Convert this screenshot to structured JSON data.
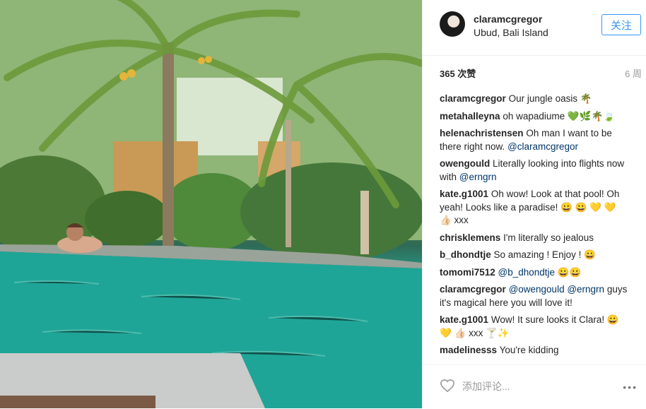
{
  "header": {
    "username": "claramcgregor",
    "location": "Ubud, Bali Island",
    "follow_label": "关注"
  },
  "stats": {
    "likes": "365 次赞",
    "ago": "6 周"
  },
  "comments": [
    {
      "user": "claramcgregor",
      "text": "Our jungle oasis 🌴"
    },
    {
      "user": "metahalleyna",
      "text": "oh wapadiume 💚🌿🌴🍃"
    },
    {
      "user": "helenachristensen",
      "text": "Oh man I want to be there right now. ",
      "mention": "@claramcgregor"
    },
    {
      "user": "owengould",
      "text": "Literally looking into flights now with ",
      "mention": "@erngrn"
    },
    {
      "user": "kate.g1001",
      "text": "Oh wow! Look at that pool! Oh yeah! Looks like a paradise! 😀 😀 💛 💛 👍🏻 xxx"
    },
    {
      "user": "chrisklemens",
      "text": "I'm literally so jealous"
    },
    {
      "user": "b_dhondtje",
      "text": "So amazing ! Enjoy ! 😀"
    },
    {
      "user": "tomomi7512",
      "text": "😀😀",
      "mention": "@b_dhondtje "
    },
    {
      "user": "claramcgregor",
      "mention": "@owengould @erngrn",
      "text": " guys it's magical here you will love it!"
    },
    {
      "user": "kate.g1001",
      "text": "Wow! It sure looks it Clara! 😀 💛 👍🏻 xxx 🍸✨"
    },
    {
      "user": "madelinesss",
      "text": "You're kidding"
    }
  ],
  "footer": {
    "add_comment_placeholder": "添加评论...",
    "more_label": "•••"
  },
  "colors": {
    "follow_blue": "#3897f0",
    "mention_blue": "#003569",
    "muted_gray": "#999999"
  },
  "icons": [
    "heart-icon",
    "more-options-icon"
  ]
}
